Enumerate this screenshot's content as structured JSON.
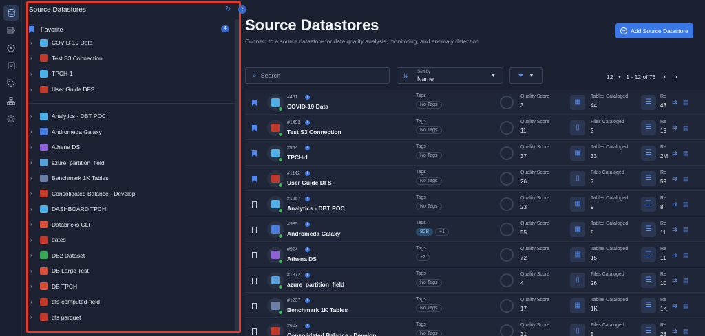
{
  "rail": {
    "icons": [
      "database-icon",
      "datastore-stack-icon",
      "compass-icon",
      "clipboard-check-icon",
      "tag-icon",
      "hierarchy-icon",
      "gear-icon"
    ]
  },
  "tree": {
    "header": "Source Datastores",
    "favorite_label": "Favorite",
    "favorite_count": "4",
    "favorites": [
      {
        "label": "COVID-19 Data",
        "color": "#4fb0e8"
      },
      {
        "label": "Test S3 Connection",
        "color": "#c0392b"
      },
      {
        "label": "TPCH-1",
        "color": "#4fb0e8"
      },
      {
        "label": "User Guide DFS",
        "color": "#c0392b"
      }
    ],
    "items": [
      {
        "label": "Analytics - DBT POC",
        "color": "#4fb0e8"
      },
      {
        "label": "Andromeda Galaxy",
        "color": "#4a7fe0"
      },
      {
        "label": "Athena DS",
        "color": "#8e5fd6"
      },
      {
        "label": "azure_partition_field",
        "color": "#5aa0d8"
      },
      {
        "label": "Benchmark 1K Tables",
        "color": "#6b7fa6"
      },
      {
        "label": "Consolidated Balance - Develop",
        "color": "#c0392b"
      },
      {
        "label": "DASHBOARD TPCH",
        "color": "#4fb0e8"
      },
      {
        "label": "Databricks CLI",
        "color": "#d9503a"
      },
      {
        "label": "dates",
        "color": "#c0392b"
      },
      {
        "label": "DB2 Dataset",
        "color": "#3aa655"
      },
      {
        "label": "DB Large Test",
        "color": "#d9503a"
      },
      {
        "label": "DB TPCH",
        "color": "#d9503a"
      },
      {
        "label": "dfs-computed-field",
        "color": "#c0392b"
      },
      {
        "label": "dfs parquet",
        "color": "#c0392b"
      }
    ]
  },
  "main": {
    "title": "Source Datastores",
    "subtitle": "Connect to a source datastore for data quality analysis, monitoring, and anomaly detection",
    "add_button": "Add Source Datastore",
    "search_placeholder": "Search",
    "sort_caption": "Sort by",
    "sort_value": "Name",
    "page_size": "12",
    "range": "1 - 12 of 76"
  },
  "rows": [
    {
      "num": "#461",
      "name": "COVID-19 Data",
      "fav": true,
      "tag": "No Tags",
      "score": "3",
      "catalog_label": "Tables Cataloged",
      "catalog": "44",
      "color": "#4fb0e8",
      "rec": "43"
    },
    {
      "num": "#1493",
      "name": "Test S3 Connection",
      "fav": true,
      "tag": "No Tags",
      "score": "11",
      "catalog_label": "Files Cataloged",
      "catalog": "3",
      "color": "#c0392b",
      "rec": "16"
    },
    {
      "num": "#844",
      "name": "TPCH-1",
      "fav": true,
      "tag": "No Tags",
      "score": "37",
      "catalog_label": "Tables Cataloged",
      "catalog": "33",
      "color": "#4fb0e8",
      "rec": "2M"
    },
    {
      "num": "#1142",
      "name": "User Guide DFS",
      "fav": true,
      "tag": "No Tags",
      "score": "26",
      "catalog_label": "Files Cataloged",
      "catalog": "7",
      "color": "#c0392b",
      "rec": "59"
    },
    {
      "num": "#1257",
      "name": "Analytics - DBT POC",
      "fav": false,
      "tag": "No Tags",
      "score": "23",
      "catalog_label": "Tables Cataloged",
      "catalog": "9",
      "color": "#4fb0e8",
      "rec": "8."
    },
    {
      "num": "#985",
      "name": "Andromeda Galaxy",
      "fav": false,
      "tag": "B2B",
      "tag_more": "+1",
      "score": "55",
      "catalog_label": "Tables Cataloged",
      "catalog": "8",
      "color": "#4a7fe0",
      "rec": "11"
    },
    {
      "num": "#924",
      "name": "Athena DS",
      "fav": false,
      "tag": "+2",
      "score": "72",
      "catalog_label": "Tables Cataloged",
      "catalog": "15",
      "color": "#8e5fd6",
      "rec": "11"
    },
    {
      "num": "#1372",
      "name": "azure_partition_field",
      "fav": false,
      "tag": "No Tags",
      "score": "4",
      "catalog_label": "Files Cataloged",
      "catalog": "26",
      "color": "#5aa0d8",
      "rec": "10"
    },
    {
      "num": "#1237",
      "name": "Benchmark 1K Tables",
      "fav": false,
      "tag": "No Tags",
      "score": "17",
      "catalog_label": "Tables Cataloged",
      "catalog": "1K",
      "color": "#6b7fa6",
      "rec": "1K"
    },
    {
      "num": "#603",
      "name": "Consolidated Balance - Develop",
      "fav": false,
      "tag": "No Tags",
      "score": "31",
      "catalog_label": "Files Cataloged",
      "catalog": "5",
      "color": "#c0392b",
      "rec": "28"
    }
  ],
  "labels": {
    "tags": "Tags",
    "quality_score": "Quality Score",
    "records": "Re"
  }
}
